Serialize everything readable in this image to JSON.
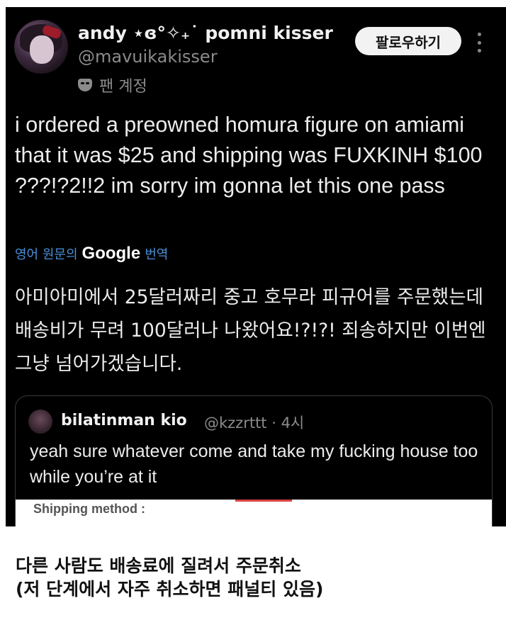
{
  "post": {
    "author_name": "andy ⋆ɞ°✧₊˙ pomni kisser",
    "author_handle": "@mavuikakisser",
    "badge_label": "팬 계정",
    "follow_label": "팔로우하기",
    "text": "i ordered a preowned homura figure on amiami that it was $25 and shipping was FUXKINH $100 ???!?2!!2 im sorry im gonna let this one pass",
    "translate_prefix": "영어 원문의",
    "translate_brand": "Google",
    "translate_suffix": "번역",
    "translated_text": "아미아미에서 25달러짜리 중고 호무라 피규어를 주문했는데 배송비가 무려 100달러나 나왔어요!?!?! 죄송하지만 이번엔 그냥 넘어가겠습니다."
  },
  "quote": {
    "author_name": "bilatinman kio",
    "author_handle": "@kzzrttt · 4시",
    "text": "yeah sure whatever come and take my fucking house too while you’re at it",
    "image_text": "Shipping method :"
  },
  "caption": {
    "line1": "다른 사람도 배송료에 질려서 주문취소",
    "line2": "(저 단계에서 자주 취소하면 패널티 있음)"
  },
  "icons": {
    "badge": "fan-mask-icon",
    "more": "more-vertical-icon"
  },
  "colors": {
    "background": "#000000",
    "text": "#ececec",
    "muted": "#8b8b8b",
    "link": "#4a8fd6",
    "follow_button": "#f2f2f2"
  }
}
